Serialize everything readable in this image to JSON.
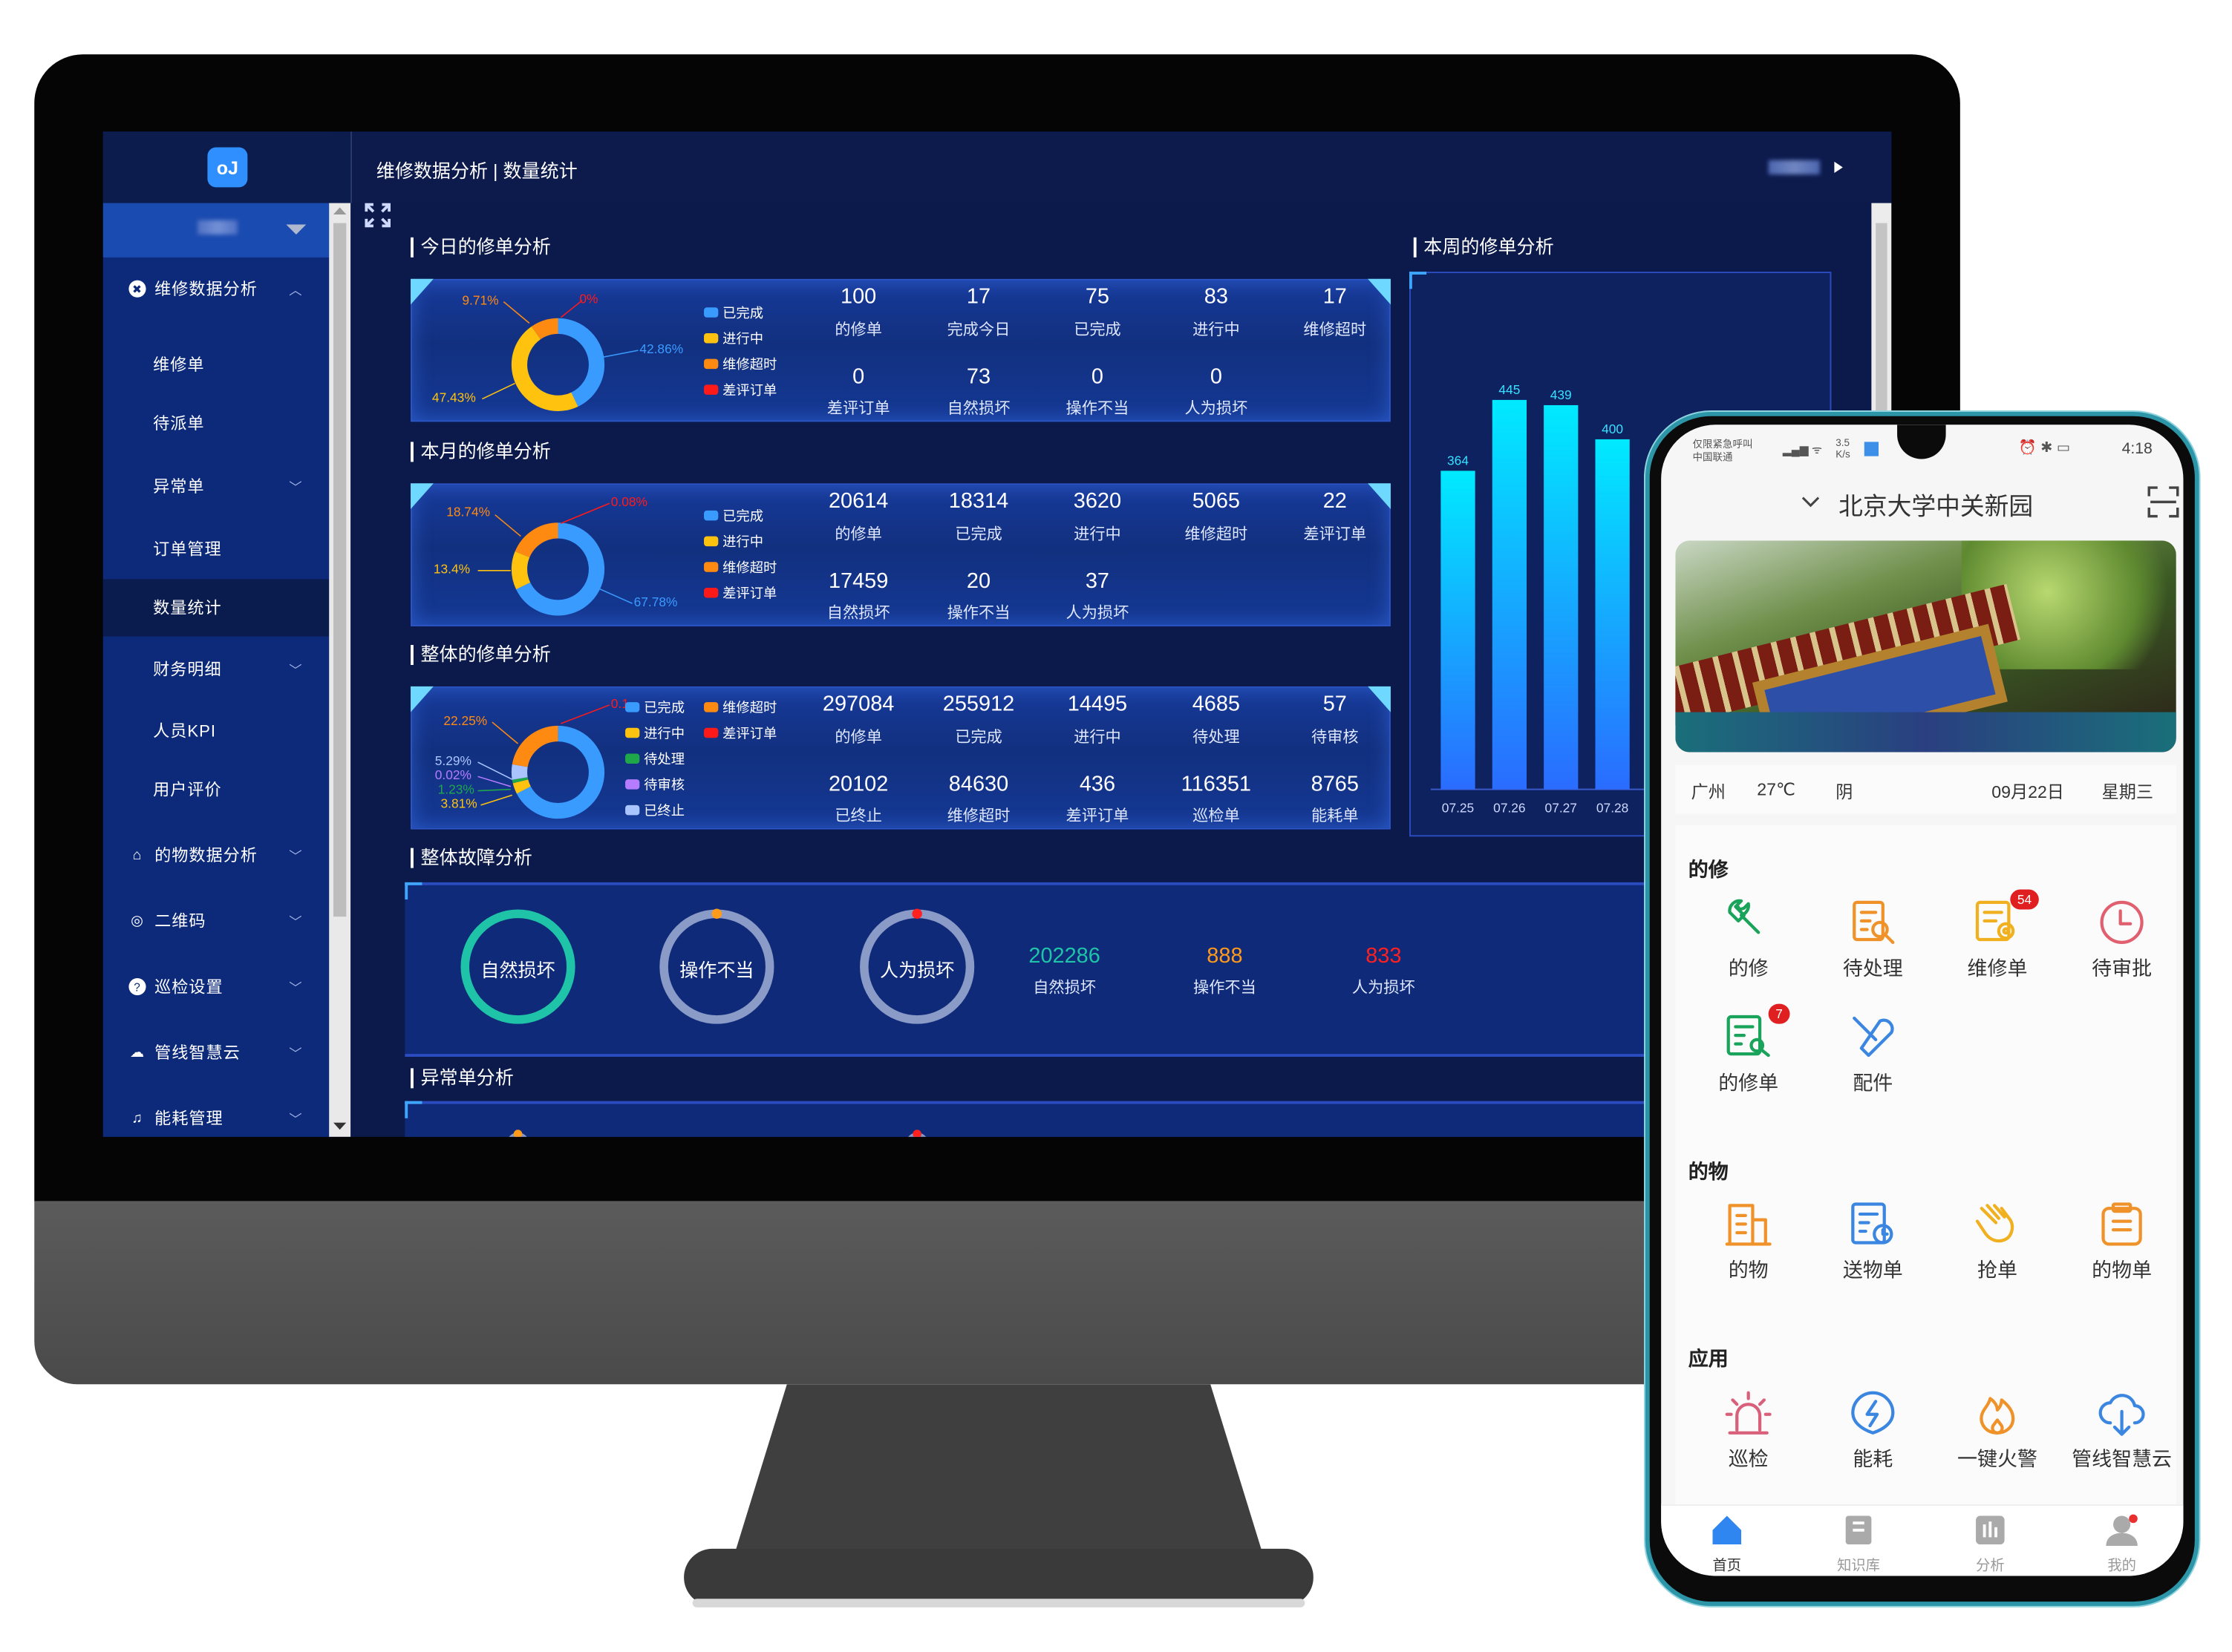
{
  "desktop": {
    "logo_text": "oJ",
    "breadcrumb": "维修数据分析 | 数量统计",
    "sidebar": {
      "items": [
        {
          "label": "维修数据分析",
          "icon": "close-circle-icon",
          "chevron": "up",
          "level": 0
        },
        {
          "label": "维修单",
          "level": 1
        },
        {
          "label": "待派单",
          "level": 1
        },
        {
          "label": "异常单",
          "level": 1,
          "chevron": "down"
        },
        {
          "label": "订单管理",
          "level": 1
        },
        {
          "label": "数量统计",
          "level": 1,
          "selected": true
        },
        {
          "label": "财务明细",
          "level": 1,
          "chevron": "down"
        },
        {
          "label": "人员KPI",
          "level": 1
        },
        {
          "label": "用户评价",
          "level": 1
        },
        {
          "label": "的物数据分析",
          "icon": "package-icon",
          "chevron": "down",
          "level": 0
        },
        {
          "label": "二维码",
          "icon": "location-pin-icon",
          "chevron": "down",
          "level": 0
        },
        {
          "label": "巡检设置",
          "icon": "help-circle-icon",
          "chevron": "down",
          "level": 0
        },
        {
          "label": "管线智慧云",
          "icon": "cloud-icon",
          "chevron": "down",
          "level": 0
        },
        {
          "label": "能耗管理",
          "icon": "bell-icon",
          "chevron": "down",
          "level": 0
        }
      ]
    },
    "sections": {
      "today": {
        "title": "今日的修单分析",
        "legend": [
          "已完成",
          "进行中",
          "维修超时",
          "差评订单"
        ],
        "donut": [
          {
            "label": "42.86%",
            "value": 42.86,
            "color": "#3a9bff"
          },
          {
            "label": "47.43%",
            "value": 47.43,
            "color": "#ffc20e"
          },
          {
            "label": "9.71%",
            "value": 9.71,
            "color": "#ff8a12"
          },
          {
            "label": "0%",
            "value": 0,
            "color": "#ff1a1a"
          }
        ],
        "stats": [
          {
            "value": "100",
            "label": "的修单"
          },
          {
            "value": "17",
            "label": "完成今日"
          },
          {
            "value": "75",
            "label": "已完成"
          },
          {
            "value": "83",
            "label": "进行中"
          },
          {
            "value": "17",
            "label": "维修超时"
          },
          {
            "value": "0",
            "label": "差评订单"
          },
          {
            "value": "73",
            "label": "自然损坏"
          },
          {
            "value": "0",
            "label": "操作不当"
          },
          {
            "value": "0",
            "label": "人为损坏"
          }
        ]
      },
      "month": {
        "title": "本月的修单分析",
        "legend": [
          "已完成",
          "进行中",
          "维修超时",
          "差评订单"
        ],
        "donut": [
          {
            "label": "67.78%",
            "value": 67.78,
            "color": "#3a9bff"
          },
          {
            "label": "13.4%",
            "value": 13.4,
            "color": "#ffc20e"
          },
          {
            "label": "18.74%",
            "value": 18.74,
            "color": "#ff8a12"
          },
          {
            "label": "0.08%",
            "value": 0.08,
            "color": "#ff1a1a"
          }
        ],
        "stats": [
          {
            "value": "20614",
            "label": "的修单"
          },
          {
            "value": "18314",
            "label": "已完成"
          },
          {
            "value": "3620",
            "label": "进行中"
          },
          {
            "value": "5065",
            "label": "维修超时"
          },
          {
            "value": "22",
            "label": "差评订单"
          },
          {
            "value": "17459",
            "label": "自然损坏"
          },
          {
            "value": "20",
            "label": "操作不当"
          },
          {
            "value": "37",
            "label": "人为损坏"
          }
        ]
      },
      "overall": {
        "title": "整体的修单分析",
        "legend": [
          "已完成",
          "维修超时",
          "进行中",
          "差评订单",
          "待处理",
          "待审核",
          "已终止"
        ],
        "donut": [
          {
            "label": "",
            "value": 67.29,
            "color": "#3a9bff"
          },
          {
            "label": "3.81%",
            "value": 3.81,
            "color": "#ffc20e"
          },
          {
            "label": "1.23%",
            "value": 1.23,
            "color": "#1fa84a"
          },
          {
            "label": "0.02%",
            "value": 0.02,
            "color": "#b57cff"
          },
          {
            "label": "5.29%",
            "value": 5.29,
            "color": "#a9c4ff"
          },
          {
            "label": "22.25%",
            "value": 22.25,
            "color": "#ff8a12"
          },
          {
            "label": "0.1",
            "value": 0.1,
            "color": "#ff1a1a"
          }
        ],
        "stats": [
          {
            "value": "297084",
            "label": "的修单"
          },
          {
            "value": "255912",
            "label": "已完成"
          },
          {
            "value": "14495",
            "label": "进行中"
          },
          {
            "value": "4685",
            "label": "待处理"
          },
          {
            "value": "57",
            "label": "待审核"
          },
          {
            "value": "20102",
            "label": "已终止"
          },
          {
            "value": "84630",
            "label": "维修超时"
          },
          {
            "value": "436",
            "label": "差评订单"
          },
          {
            "value": "116351",
            "label": "巡检单"
          },
          {
            "value": "8765",
            "label": "能耗单"
          }
        ]
      },
      "fault": {
        "title": "整体故障分析",
        "rings": [
          {
            "label": "自然损坏",
            "color": "#1fc4a8"
          },
          {
            "label": "操作不当",
            "color": "#ff9a1a"
          },
          {
            "label": "人为损坏",
            "color": "#ff2020"
          }
        ],
        "totals": [
          {
            "value": "202286",
            "label": "自然损坏",
            "color": "#1fc4a8"
          },
          {
            "value": "888",
            "label": "操作不当",
            "color": "#ff9a1a"
          },
          {
            "value": "833",
            "label": "人为损坏",
            "color": "#ff2020"
          }
        ]
      },
      "abnormal": {
        "title": "异常单分析"
      },
      "week": {
        "title": "本周的修单分析",
        "chart_data": {
          "type": "bar",
          "categories": [
            "07.25",
            "07.26",
            "07.27",
            "07.28"
          ],
          "values": [
            364,
            445,
            439,
            400
          ]
        }
      }
    }
  },
  "phone": {
    "status": {
      "carrier_line1": "仅限紧急呼叫",
      "carrier_line2": "中国联通",
      "speed": "3.5 K/s",
      "time": "4:18"
    },
    "campus": "北京大学中关新园",
    "weather": {
      "city": "广州",
      "temp": "27℃",
      "condition": "阴",
      "date": "09月22日",
      "weekday": "星期三"
    },
    "groups": [
      {
        "title": "的修",
        "apps": [
          {
            "label": "的修",
            "icon": "wrench-icon",
            "color": "#1aa35a"
          },
          {
            "label": "待处理",
            "icon": "doc-search-icon",
            "color": "#f0922a"
          },
          {
            "label": "维修单",
            "icon": "doc-gear-icon",
            "color": "#f0b020",
            "badge": "54"
          },
          {
            "label": "待审批",
            "icon": "clock-icon",
            "color": "#e06070"
          },
          {
            "label": "的修单",
            "icon": "doc-wrench-icon",
            "color": "#1aa35a",
            "badge": "7"
          },
          {
            "label": "配件",
            "icon": "tools-icon",
            "color": "#3a86e0"
          }
        ]
      },
      {
        "title": "的物",
        "apps": [
          {
            "label": "的物",
            "icon": "building-icon",
            "color": "#f0922a"
          },
          {
            "label": "送物单",
            "icon": "doc-clock-icon",
            "color": "#3a86e0"
          },
          {
            "label": "抢单",
            "icon": "hand-icon",
            "color": "#f0b020"
          },
          {
            "label": "的物单",
            "icon": "clipboard-icon",
            "color": "#f0922a"
          }
        ]
      },
      {
        "title": "应用",
        "apps": [
          {
            "label": "巡检",
            "icon": "alarm-light-icon",
            "color": "#d8607a"
          },
          {
            "label": "能耗",
            "icon": "energy-icon",
            "color": "#3a86e0"
          },
          {
            "label": "一键火警",
            "icon": "fire-icon",
            "color": "#f0922a"
          },
          {
            "label": "管线智慧云",
            "icon": "cloud-download-icon",
            "color": "#3a86e0"
          }
        ]
      }
    ],
    "nav": [
      {
        "label": "首页",
        "icon": "home-icon",
        "active": true
      },
      {
        "label": "知识库",
        "icon": "book-icon"
      },
      {
        "label": "分析",
        "icon": "chart-icon"
      },
      {
        "label": "我的",
        "icon": "user-icon"
      }
    ],
    "colors": {
      "accent": "#2f86f0"
    }
  }
}
